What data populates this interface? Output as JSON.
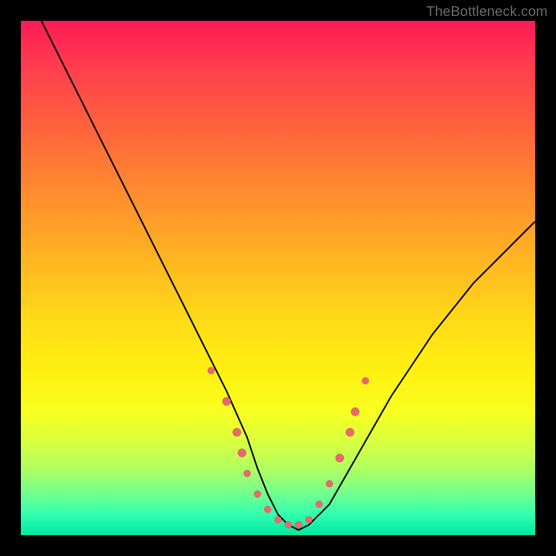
{
  "watermark": "TheBottleneck.com",
  "colors": {
    "frame": "#000000",
    "curve": "#000000",
    "marker_fill": "#e86a6a",
    "marker_stroke": "#d25a5a",
    "gradient_top": "#ff1a55",
    "gradient_bottom": "#00e8a0"
  },
  "chart_data": {
    "type": "line",
    "title": "",
    "xlabel": "",
    "ylabel": "",
    "xlim": [
      0,
      100
    ],
    "ylim": [
      0,
      100
    ],
    "grid": false,
    "legend": false,
    "series": [
      {
        "name": "curve",
        "x": [
          4,
          8,
          12,
          16,
          20,
          24,
          28,
          32,
          36,
          40,
          44,
          46,
          48,
          50,
          52,
          54,
          56,
          60,
          64,
          68,
          72,
          76,
          80,
          84,
          88,
          92,
          96,
          100
        ],
        "values": [
          100,
          92,
          84,
          76,
          68,
          60,
          52,
          44,
          36,
          28,
          19,
          13,
          8,
          4,
          2,
          1,
          2,
          6,
          13,
          20,
          27,
          33,
          39,
          44,
          49,
          53,
          57,
          61
        ]
      }
    ],
    "markers": [
      {
        "x": 37,
        "y": 32,
        "r": 5
      },
      {
        "x": 40,
        "y": 26,
        "r": 6
      },
      {
        "x": 42,
        "y": 20,
        "r": 6
      },
      {
        "x": 43,
        "y": 16,
        "r": 6
      },
      {
        "x": 44,
        "y": 12,
        "r": 5
      },
      {
        "x": 46,
        "y": 8,
        "r": 5
      },
      {
        "x": 48,
        "y": 5,
        "r": 5
      },
      {
        "x": 50,
        "y": 3,
        "r": 5
      },
      {
        "x": 52,
        "y": 2,
        "r": 5
      },
      {
        "x": 54,
        "y": 2,
        "r": 5
      },
      {
        "x": 56,
        "y": 3,
        "r": 5
      },
      {
        "x": 58,
        "y": 6,
        "r": 5
      },
      {
        "x": 60,
        "y": 10,
        "r": 5
      },
      {
        "x": 62,
        "y": 15,
        "r": 6
      },
      {
        "x": 64,
        "y": 20,
        "r": 6
      },
      {
        "x": 65,
        "y": 24,
        "r": 6
      },
      {
        "x": 67,
        "y": 30,
        "r": 5
      }
    ]
  }
}
